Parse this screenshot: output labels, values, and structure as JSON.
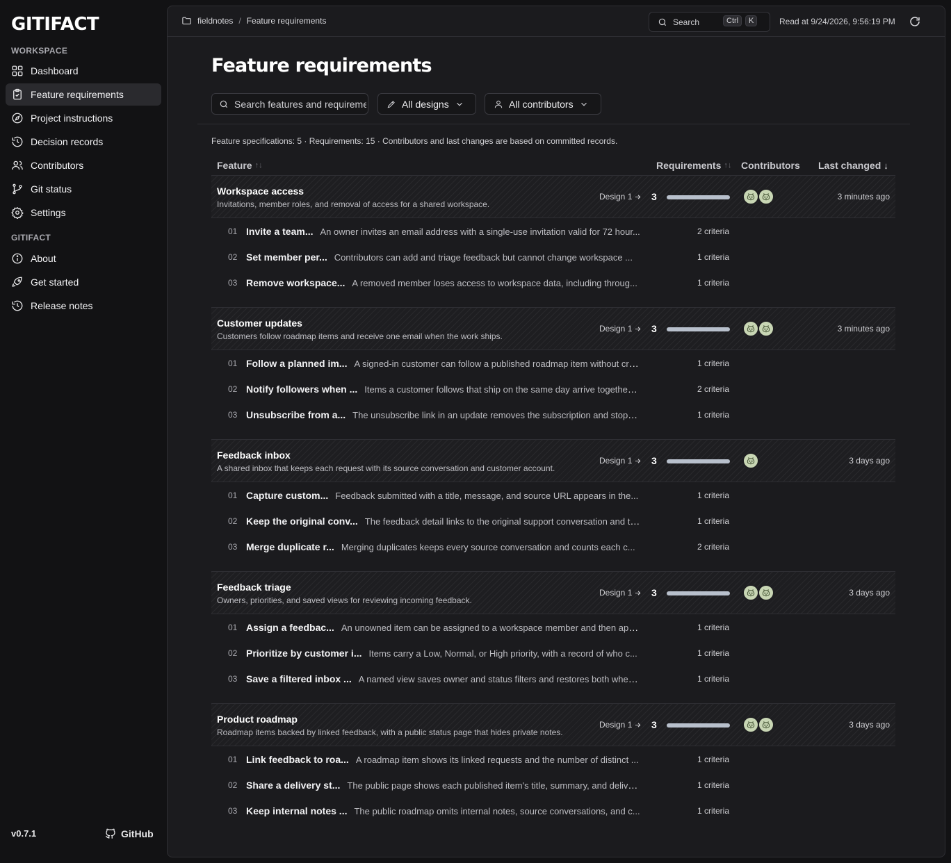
{
  "app": {
    "logo": "GITIFACT",
    "version": "v0.7.1",
    "github_label": "GitHub"
  },
  "sidebar": {
    "workspace_label": "WORKSPACE",
    "workspace_items": [
      {
        "label": "Dashboard",
        "icon": "grid-icon"
      },
      {
        "label": "Feature requirements",
        "icon": "clipboard-icon",
        "active": true
      },
      {
        "label": "Project instructions",
        "icon": "compass-icon"
      },
      {
        "label": "Decision records",
        "icon": "history-icon"
      },
      {
        "label": "Contributors",
        "icon": "users-icon"
      },
      {
        "label": "Git status",
        "icon": "git-branch-icon"
      },
      {
        "label": "Settings",
        "icon": "gear-icon"
      }
    ],
    "gitifact_label": "GITIFACT",
    "gitifact_items": [
      {
        "label": "About",
        "icon": "info-icon"
      },
      {
        "label": "Get started",
        "icon": "rocket-icon"
      },
      {
        "label": "Release notes",
        "icon": "history-icon"
      }
    ]
  },
  "topbar": {
    "breadcrumb_root": "fieldnotes",
    "breadcrumb_sep": "/",
    "breadcrumb_current": "Feature requirements",
    "search_label": "Search",
    "kbd_ctrl": "Ctrl",
    "kbd_k": "K",
    "read_at": "Read at 9/24/2026, 9:56:19 PM"
  },
  "main": {
    "title": "Feature requirements",
    "search_placeholder": "Search features and requirements",
    "designs_filter": "All designs",
    "contributors_filter": "All contributors",
    "summary": "Feature specifications: 5 · Requirements: 15 · Contributors and last changes are based on committed records.",
    "columns": {
      "feature": "Feature",
      "requirements": "Requirements",
      "contributors": "Contributors",
      "last_changed": "Last changed"
    }
  },
  "features": [
    {
      "title": "Workspace access",
      "desc": "Invitations, member roles, and removal of access for a shared workspace.",
      "design": "Design 1",
      "count": "3",
      "avatars": 2,
      "changed": "3 minutes ago",
      "reqs": [
        {
          "num": "01",
          "title": "Invite a team...",
          "desc": "An owner invites an email address with a single-use invitation valid for 72 hour...",
          "crit": "2 criteria"
        },
        {
          "num": "02",
          "title": "Set member per...",
          "desc": "Contributors can add and triage feedback but cannot change workspace ...",
          "crit": "1 criteria"
        },
        {
          "num": "03",
          "title": "Remove workspace...",
          "desc": "A removed member loses access to workspace data, including throug...",
          "crit": "1 criteria"
        }
      ]
    },
    {
      "title": "Customer updates",
      "desc": "Customers follow roadmap items and receive one email when the work ships.",
      "design": "Design 1",
      "count": "3",
      "avatars": 2,
      "changed": "3 minutes ago",
      "reqs": [
        {
          "num": "01",
          "title": "Follow a planned im...",
          "desc": "A signed-in customer can follow a published roadmap item without cre...",
          "crit": "1 criteria"
        },
        {
          "num": "02",
          "title": "Notify followers when ...",
          "desc": "Items a customer follows that ship on the same day arrive together ...",
          "crit": "2 criteria"
        },
        {
          "num": "03",
          "title": "Unsubscribe from a...",
          "desc": "The unsubscribe link in an update removes the subscription and stops l...",
          "crit": "1 criteria"
        }
      ]
    },
    {
      "title": "Feedback inbox",
      "desc": "A shared inbox that keeps each request with its source conversation and customer account.",
      "design": "Design 1",
      "count": "3",
      "avatars": 1,
      "changed": "3 days ago",
      "reqs": [
        {
          "num": "01",
          "title": "Capture custom...",
          "desc": "Feedback submitted with a title, message, and source URL appears in the...",
          "crit": "1 criteria"
        },
        {
          "num": "02",
          "title": "Keep the original conv...",
          "desc": "The feedback detail links to the original support conversation and th...",
          "crit": "1 criteria"
        },
        {
          "num": "03",
          "title": "Merge duplicate r...",
          "desc": "Merging duplicates keeps every source conversation and counts each c...",
          "crit": "2 criteria"
        }
      ]
    },
    {
      "title": "Feedback triage",
      "desc": "Owners, priorities, and saved views for reviewing incoming feedback.",
      "design": "Design 1",
      "count": "3",
      "avatars": 2,
      "changed": "3 days ago",
      "reqs": [
        {
          "num": "01",
          "title": "Assign a feedbac...",
          "desc": "An unowned item can be assigned to a workspace member and then app...",
          "crit": "1 criteria"
        },
        {
          "num": "02",
          "title": "Prioritize by customer i...",
          "desc": "Items carry a Low, Normal, or High priority, with a record of who c...",
          "crit": "1 criteria"
        },
        {
          "num": "03",
          "title": "Save a filtered inbox ...",
          "desc": "A named view saves owner and status filters and restores both when...",
          "crit": "1 criteria"
        }
      ]
    },
    {
      "title": "Product roadmap",
      "desc": "Roadmap items backed by linked feedback, with a public status page that hides private notes.",
      "design": "Design 1",
      "count": "3",
      "avatars": 2,
      "changed": "3 days ago",
      "reqs": [
        {
          "num": "01",
          "title": "Link feedback to roa...",
          "desc": "A roadmap item shows its linked requests and the number of distinct ...",
          "crit": "1 criteria"
        },
        {
          "num": "02",
          "title": "Share a delivery st...",
          "desc": "The public page shows each published item's title, summary, and delive...",
          "crit": "1 criteria"
        },
        {
          "num": "03",
          "title": "Keep internal notes ...",
          "desc": "The public roadmap omits internal notes, source conversations, and c...",
          "crit": "1 criteria"
        }
      ]
    }
  ]
}
